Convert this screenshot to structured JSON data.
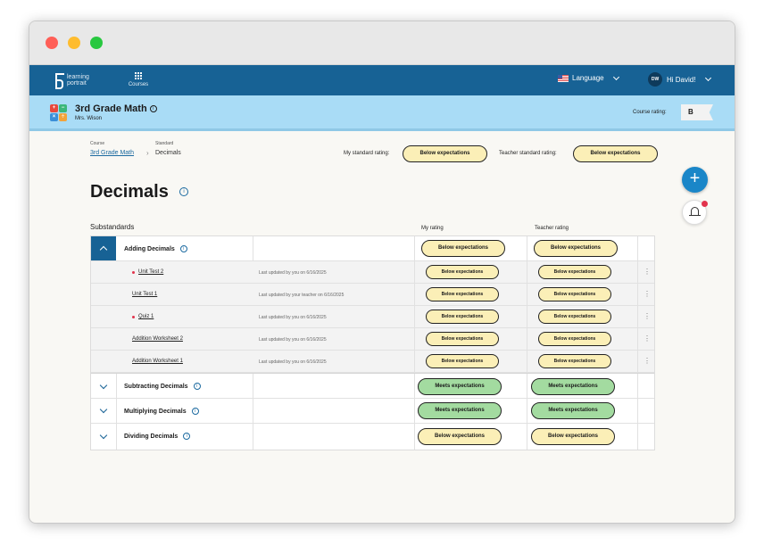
{
  "app": {
    "logo_text": "learning portrait",
    "courses_label": "Courses",
    "language_label": "Language",
    "user_initials": "DW",
    "greeting": "Hi David!"
  },
  "course": {
    "title": "3rd Grade Math",
    "teacher": "Mrs. Wison",
    "rating_label": "Course rating:",
    "rating": "B",
    "icon_colors": [
      "#e8483c",
      "#3ab77a",
      "#3a8fd8",
      "#f2a33a"
    ]
  },
  "breadcrumb": {
    "course_label": "Course",
    "course": "3rd Grade Math",
    "standard_label": "Standard",
    "standard": "Decimals"
  },
  "standard_ratings": {
    "my_label": "My standard rating:",
    "my": "Below expectations",
    "teacher_label": "Teacher standard rating:",
    "teacher": "Below expectations"
  },
  "page_title": "Decimals",
  "table": {
    "substandards_label": "Substandards",
    "my_rating_label": "My rating",
    "teacher_rating_label": "Teacher rating",
    "rows": [
      {
        "title": "Adding Decimals",
        "my": "Below expectations",
        "teacher": "Below expectations"
      },
      {
        "title": "Subtracting Decimals",
        "my": "Meets  expectations",
        "teacher": "Meets expectations"
      },
      {
        "title": "Multiplying Decimals",
        "my": "Meets  expectations",
        "teacher": "Meets expectations"
      },
      {
        "title": "Dividing Decimals",
        "my": "Below expectations",
        "teacher": "Below expectations"
      }
    ],
    "children": [
      {
        "name": "Unit Test 2",
        "updated": "Last updated by you on 6/16/2025",
        "my": "Below expectations",
        "teacher": "Below expectations"
      },
      {
        "name": "Unit Test 1",
        "updated": "Last updated by your teacher on 6/16/2025",
        "my": "Below expectations",
        "teacher": "Below expectations"
      },
      {
        "name": "Quiz 1",
        "updated": "Last updated by you on 6/16/2025",
        "my": "Below expectations",
        "teacher": "Below expectations"
      },
      {
        "name": "Addition Worksheet 2",
        "updated": "Last updated by you on 6/16/2025",
        "my": "Below expectations",
        "teacher": "Below expectations"
      },
      {
        "name": "Addition Worksheet 1",
        "updated": "Last updated by you on 6/16/2025",
        "my": "Below expectations",
        "teacher": "Below expectations"
      }
    ]
  },
  "icons": {
    "add": "+",
    "info": "i",
    "kebab": "⋮"
  }
}
